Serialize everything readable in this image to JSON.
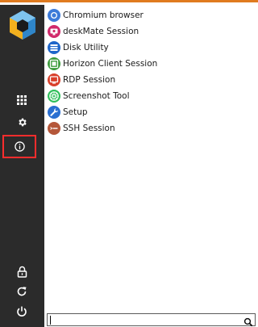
{
  "sidebar": {
    "logo_icon": "cube-logo-icon",
    "buttons": [
      {
        "name": "apps-grid-button",
        "icon": "grid-icon"
      },
      {
        "name": "settings-button",
        "icon": "gear-icon"
      },
      {
        "name": "info-button",
        "icon": "info-icon",
        "highlighted": true
      },
      {
        "name": "lock-button",
        "icon": "lock-icon"
      },
      {
        "name": "refresh-button",
        "icon": "refresh-icon"
      },
      {
        "name": "power-button",
        "icon": "power-icon"
      }
    ],
    "highlight_color": "#ff2d2d"
  },
  "apps": [
    {
      "label": "Chromium browser",
      "icon": "chromium-icon",
      "color": "#3d7bd9"
    },
    {
      "label": "deskMate Session",
      "icon": "deskmate-icon",
      "color": "#d12a6b"
    },
    {
      "label": "Disk Utility",
      "icon": "disk-icon",
      "color": "#1f66c9"
    },
    {
      "label": "Horizon Client Session",
      "icon": "horizon-icon",
      "color": "#3c9b3c"
    },
    {
      "label": "RDP Session",
      "icon": "rdp-icon",
      "color": "#d9402b"
    },
    {
      "label": "Screenshot Tool",
      "icon": "screenshot-icon",
      "color": "#2fbf5a"
    },
    {
      "label": "Setup",
      "icon": "setup-icon",
      "color": "#2a6fd1"
    },
    {
      "label": "SSH Session",
      "icon": "ssh-icon",
      "color": "#b5573a"
    }
  ],
  "search": {
    "value": "",
    "placeholder": "",
    "icon": "search-icon"
  },
  "colors": {
    "top_accent": "#e07b1f",
    "sidebar_bg": "#2b2b2b"
  }
}
